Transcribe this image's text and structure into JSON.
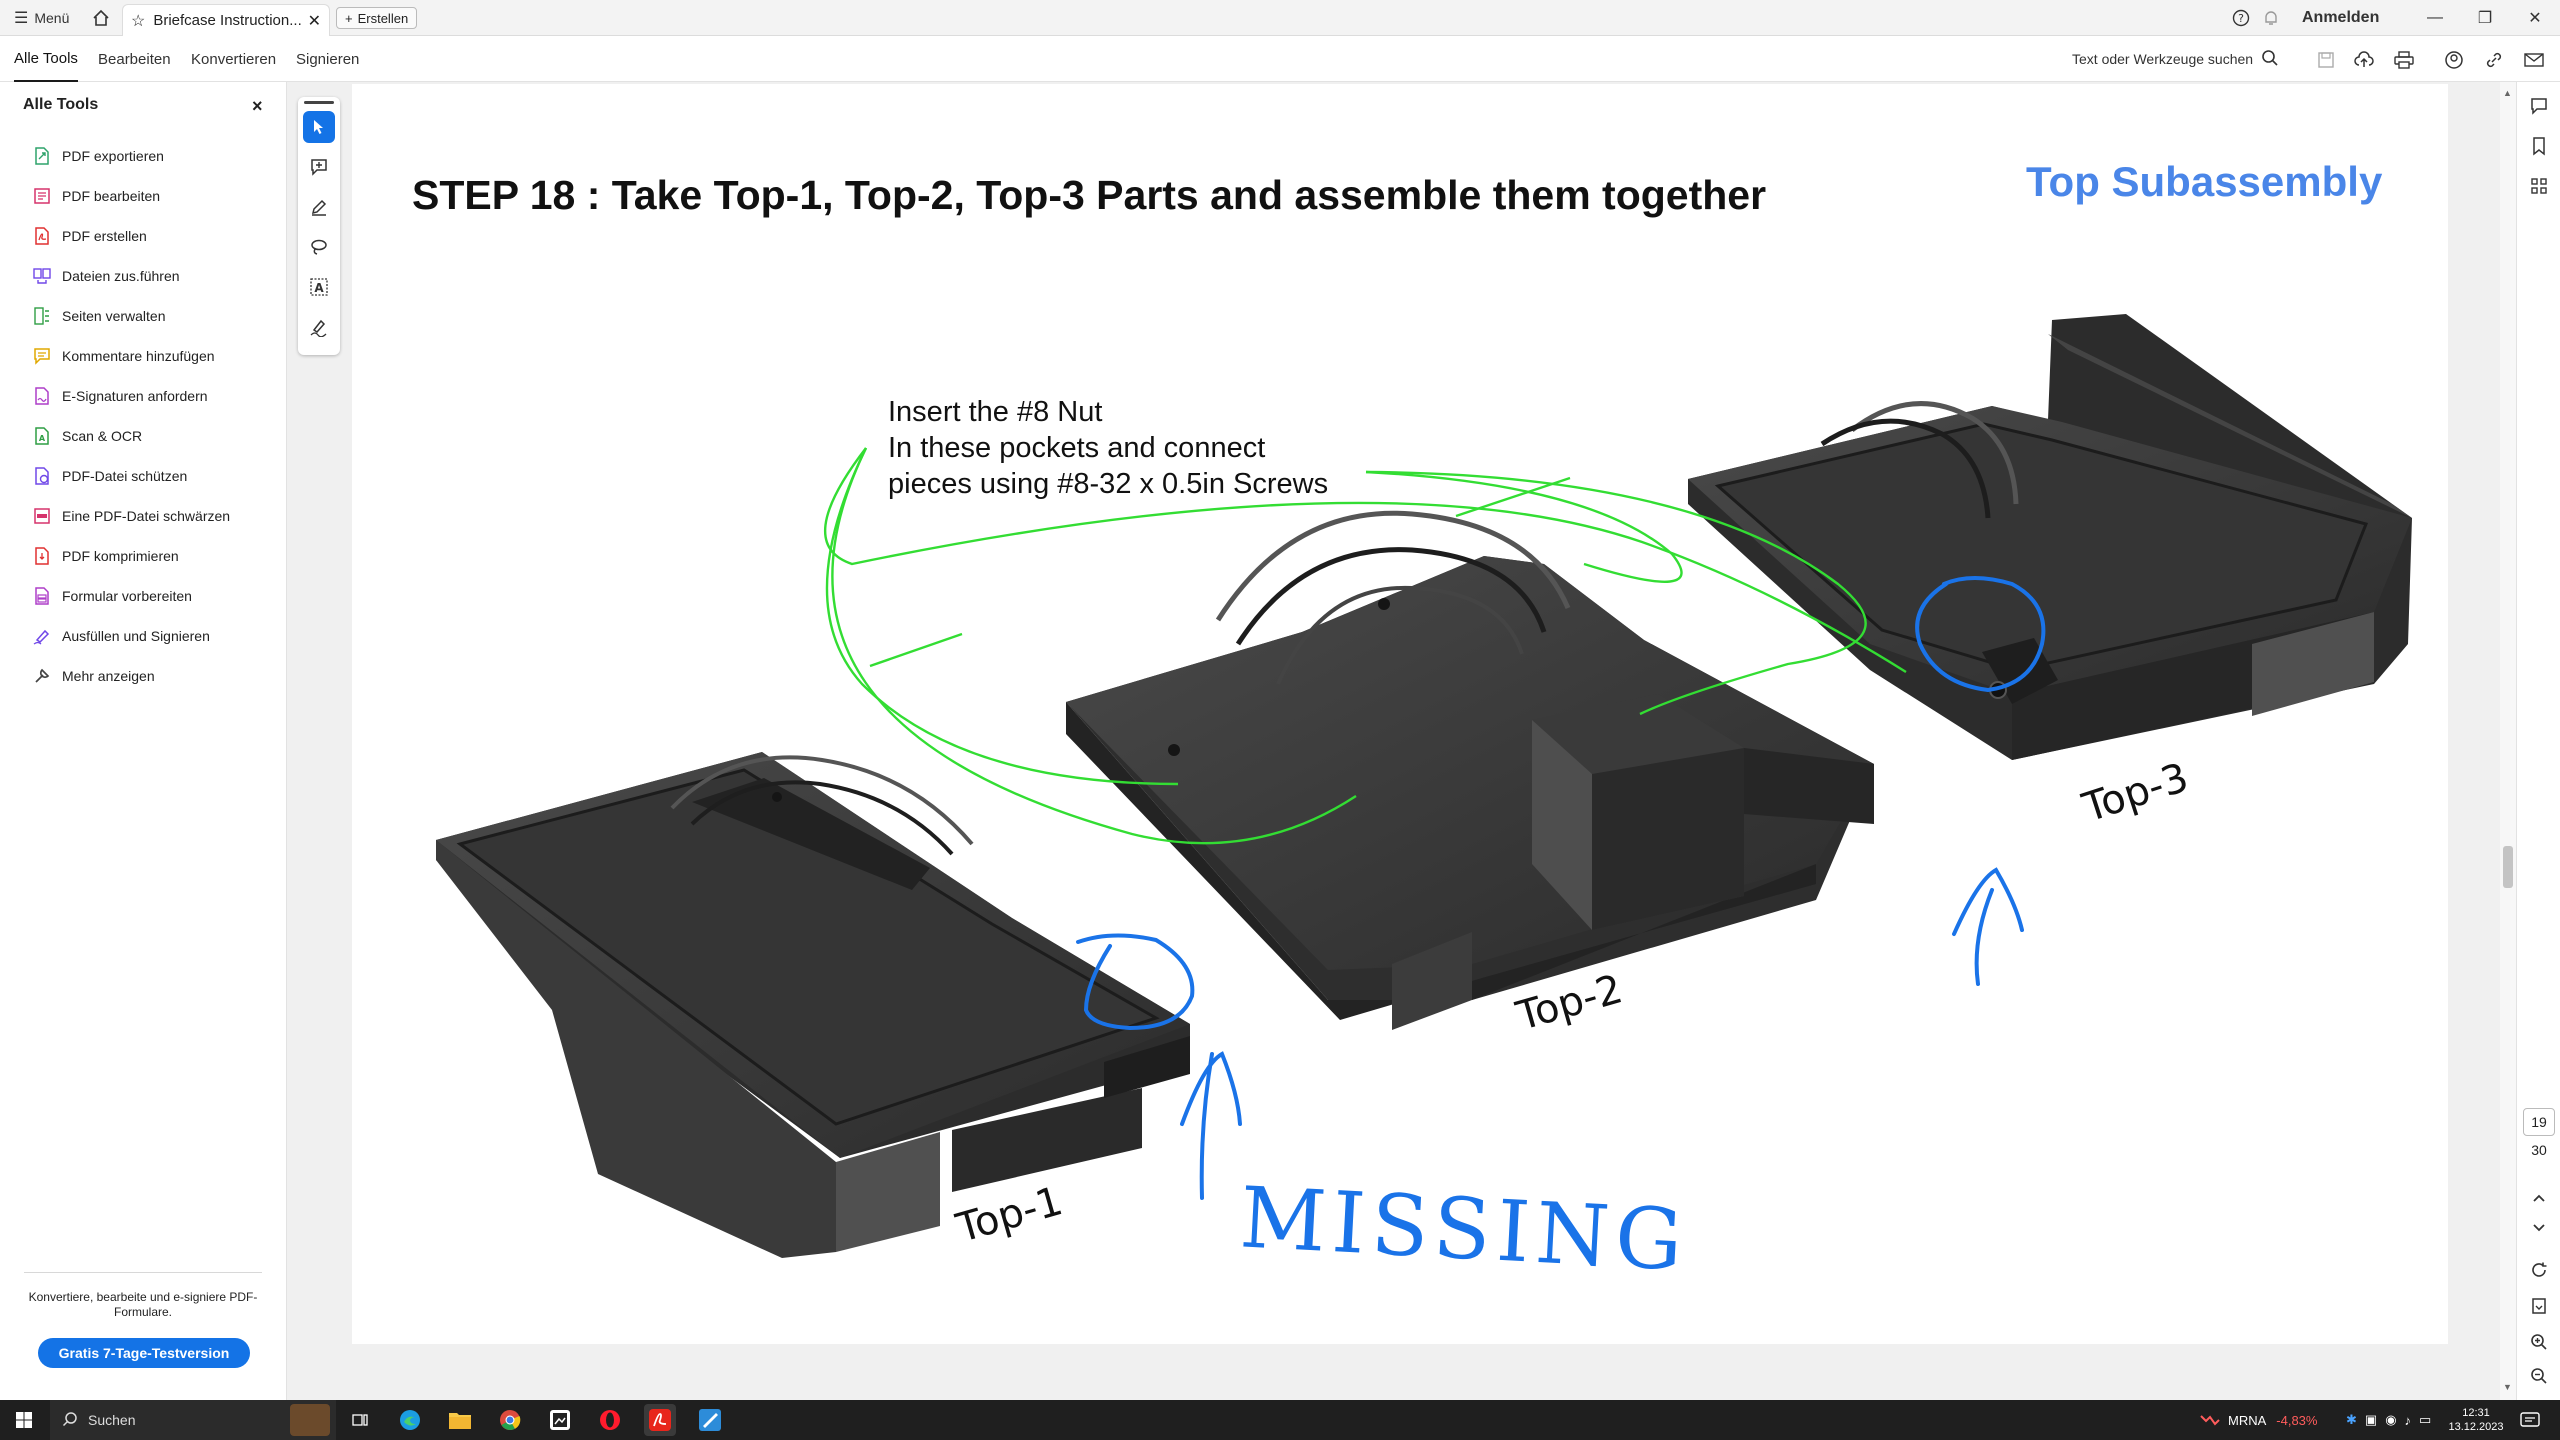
{
  "titlebar": {
    "menu_label": "Menü",
    "tab_title": "Briefcase Instruction...",
    "create_label": "Erstellen",
    "signin_label": "Anmelden"
  },
  "menubar": {
    "items": [
      "Alle Tools",
      "Bearbeiten",
      "Konvertieren",
      "Signieren"
    ],
    "search_label": "Text oder Werkzeuge suchen"
  },
  "leftpanel": {
    "title": "Alle Tools",
    "close": "×",
    "items": [
      {
        "label": "PDF exportieren",
        "icon": "export-pdf-icon",
        "color": "#2ea36b"
      },
      {
        "label": "PDF bearbeiten",
        "icon": "edit-pdf-icon",
        "color": "#d6336c"
      },
      {
        "label": "PDF erstellen",
        "icon": "create-pdf-icon",
        "color": "#e03131"
      },
      {
        "label": "Dateien zus.führen",
        "icon": "combine-files-icon",
        "color": "#7048e8"
      },
      {
        "label": "Seiten verwalten",
        "icon": "organize-pages-icon",
        "color": "#2f9e44"
      },
      {
        "label": "Kommentare hinzufügen",
        "icon": "comment-icon",
        "color": "#e0a800"
      },
      {
        "label": "E-Signaturen anfordern",
        "icon": "request-signature-icon",
        "color": "#ae3ec9"
      },
      {
        "label": "Scan & OCR",
        "icon": "scan-ocr-icon",
        "color": "#2f9e44"
      },
      {
        "label": "PDF-Datei schützen",
        "icon": "protect-pdf-icon",
        "color": "#7048e8"
      },
      {
        "label": "Eine PDF-Datei schwärzen",
        "icon": "redact-pdf-icon",
        "color": "#d6336c"
      },
      {
        "label": "PDF komprimieren",
        "icon": "compress-pdf-icon",
        "color": "#e03131"
      },
      {
        "label": "Formular vorbereiten",
        "icon": "prepare-form-icon",
        "color": "#ae3ec9"
      },
      {
        "label": "Ausfüllen und Signieren",
        "icon": "fill-sign-icon",
        "color": "#7048e8"
      },
      {
        "label": "Mehr anzeigen",
        "icon": "more-tools-icon",
        "color": "#444444"
      }
    ],
    "promo_text": "Konvertiere, bearbeite und e-signiere PDF-Formulare.",
    "trial_button": "Gratis 7-Tage-Testversion"
  },
  "document": {
    "step_title": "STEP 18 : Take Top-1, Top-2, Top-3 Parts and assemble them together",
    "subassembly": "Top Subassembly",
    "note_lines": [
      "Insert the #8 Nut",
      "In these pockets and connect",
      "pieces using #8-32 x 0.5in Screws"
    ],
    "part_labels": [
      "Top-1",
      "Top-2",
      "Top-3"
    ],
    "handwritten": "MISSING"
  },
  "pagenav": {
    "current": "19",
    "total": "30"
  },
  "taskbar": {
    "search_label": "Suchen",
    "stock_ticker": "MRNA",
    "stock_change": "-4,83%",
    "time": "12:31",
    "date": "13.12.2023"
  },
  "colors": {
    "accent": "#1473e6",
    "subassembly": "#4a86e8",
    "arrow_green": "#33dd33",
    "annotation_blue": "#1a73e8",
    "stock_down": "#ff5c5c"
  }
}
